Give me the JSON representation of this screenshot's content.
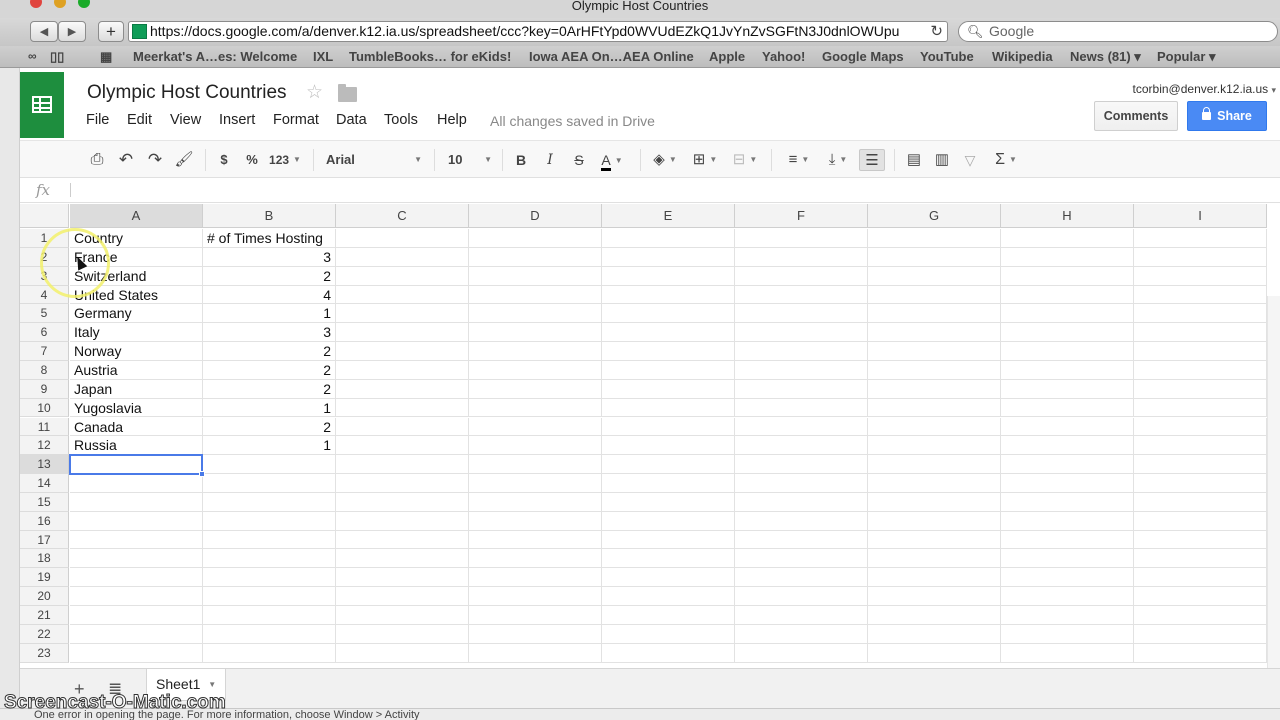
{
  "window": {
    "title": "Olympic Host Countries"
  },
  "browser": {
    "url": "https://docs.google.com/a/denver.k12.ia.us/spreadsheet/ccc?key=0ArHFtYpd0WVUdEZkQ1JvYnZvSGFtN3J0dnlOWUpu",
    "search_placeholder": "Google",
    "bookmarks": [
      "Meerkat's A…es: Welcome",
      "IXL",
      "TumbleBooks… for eKids!",
      "Iowa AEA On…AEA Online",
      "Apple",
      "Yahoo!",
      "Google Maps",
      "YouTube",
      "Wikipedia",
      "News (81) ▾",
      "Popular ▾"
    ]
  },
  "doc": {
    "title": "Olympic Host Countries",
    "save_status": "All changes saved in Drive",
    "account": "tcorbin@denver.k12.ia.us",
    "comments_label": "Comments",
    "share_label": "Share"
  },
  "menus": [
    "File",
    "Edit",
    "View",
    "Insert",
    "Format",
    "Data",
    "Tools",
    "Help"
  ],
  "toolbar": {
    "currency": "$",
    "percent": "%",
    "number_format": "123",
    "font": "Arial",
    "font_size": "10",
    "bold": "B",
    "italic": "I",
    "strike": "S",
    "text_color": "A",
    "sum": "Σ"
  },
  "formula_bar": {
    "fx": "fx",
    "value": ""
  },
  "grid": {
    "columns": [
      "A",
      "B",
      "C",
      "D",
      "E",
      "F",
      "G",
      "H",
      "I"
    ],
    "rows": [
      "1",
      "2",
      "3",
      "4",
      "5",
      "6",
      "7",
      "8",
      "9",
      "10",
      "11",
      "12",
      "13",
      "14",
      "15",
      "16",
      "17",
      "18",
      "19",
      "20",
      "21",
      "22",
      "23"
    ],
    "selected_cell": "A13",
    "cells": [
      [
        "Country",
        "# of Times Hosting"
      ],
      [
        "France",
        "3"
      ],
      [
        "Switzerland",
        "2"
      ],
      [
        "United States",
        "4"
      ],
      [
        "Germany",
        "1"
      ],
      [
        "Italy",
        "3"
      ],
      [
        "Norway",
        "2"
      ],
      [
        "Austria",
        "2"
      ],
      [
        "Japan",
        "2"
      ],
      [
        "Yugoslavia",
        "1"
      ],
      [
        "Canada",
        "2"
      ],
      [
        "Russia",
        "1"
      ]
    ]
  },
  "sheet_tabs": [
    "Sheet1"
  ],
  "status_text": "One error in opening the page. For more information, choose Window > Activity",
  "watermark": "Screencast-O-Matic.com",
  "colors": {
    "brand_green": "#1e8e3e",
    "share_blue": "#4a8af4",
    "selection_blue": "#4a7ae8"
  }
}
